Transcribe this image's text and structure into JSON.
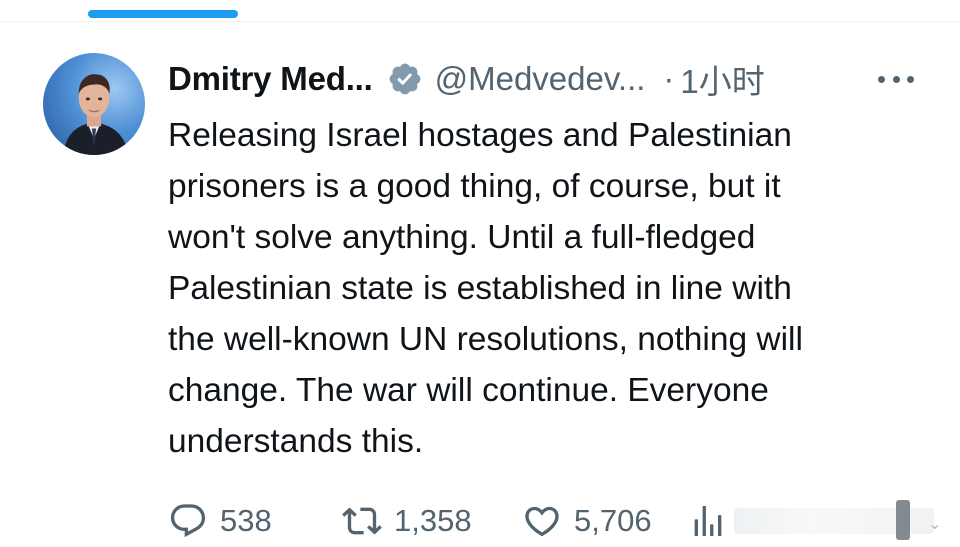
{
  "tweet": {
    "author": {
      "display_name": "Dmitry Med...",
      "handle": "@Medvedev...",
      "verified": true,
      "avatar_icon": "profile-photo"
    },
    "separator": "·",
    "time": "1小时",
    "text_lines": [
      "Releasing Israel hostages and Palestinian",
      "prisoners is a good thing, of course, but it",
      "won't solve anything. Until a full-fledged",
      "Palestinian state is established in line with",
      "the well-known UN resolutions, nothing will",
      "change. The war will continue. Everyone",
      "understands this."
    ],
    "actions": {
      "reply": {
        "icon": "reply-icon",
        "count": "538"
      },
      "retweet": {
        "icon": "retweet-icon",
        "count": "1,358"
      },
      "like": {
        "icon": "heart-icon",
        "count": "5,706"
      },
      "views": {
        "icon": "analytics-icon"
      }
    }
  },
  "colors": {
    "accent": "#1d9bf0",
    "text_primary": "#0f1419",
    "text_secondary": "#536471",
    "verified_badge": "#829aab"
  }
}
